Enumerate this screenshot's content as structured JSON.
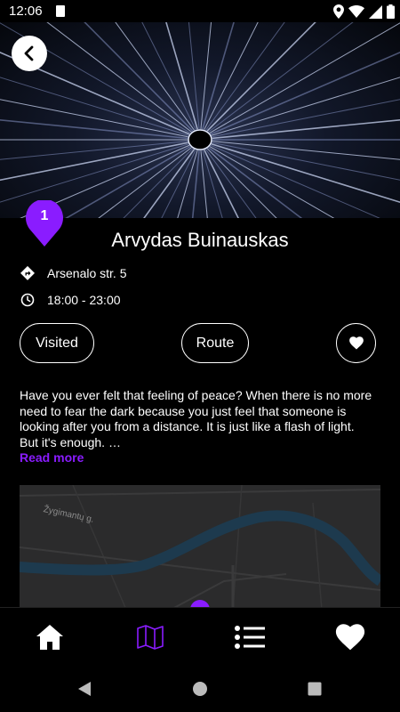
{
  "status_bar": {
    "time": "12:06",
    "icons": [
      "sd-card-icon",
      "location-icon",
      "wifi-icon",
      "signal-icon",
      "battery-icon"
    ]
  },
  "hero": {
    "image": "light-rays-tunnel-photo",
    "back_icon": "chevron-left-icon"
  },
  "place": {
    "number": "1",
    "name": "Arvydas Buinauskas",
    "address": "Arsenalo str. 5",
    "hours": "18:00 - 23:00"
  },
  "actions": {
    "visited_label": "Visited",
    "route_label": "Route",
    "favorite_icon": "heart-icon"
  },
  "description": {
    "lines": [
      "Have you ever felt that feeling of peace? When there is no more",
      "need to fear the dark because you just feel that someone is",
      "looking after you from a distance. It is just like a flash of light.",
      "But it's enough. …"
    ],
    "read_more": "Read more"
  },
  "map": {
    "street_label": "Žygimantų g."
  },
  "bottom_nav": [
    {
      "name": "home",
      "icon": "home-icon",
      "active": false
    },
    {
      "name": "map",
      "icon": "map-icon",
      "active": true
    },
    {
      "name": "list",
      "icon": "list-icon",
      "active": false
    },
    {
      "name": "favorites",
      "icon": "heart-icon",
      "active": false
    }
  ],
  "colors": {
    "accent": "#8a1cff",
    "background": "#000000",
    "map_bg": "#2b2b2c",
    "river": "#1d3a4e"
  }
}
